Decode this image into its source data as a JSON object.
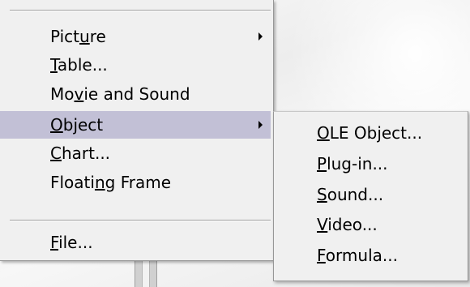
{
  "menu": {
    "items": [
      {
        "before": "Pict",
        "accel": "u",
        "after": "re",
        "has_submenu": true,
        "selected": false
      },
      {
        "before": "",
        "accel": "T",
        "after": "able...",
        "has_submenu": false,
        "selected": false
      },
      {
        "before": "Mo",
        "accel": "v",
        "after": "ie and Sound",
        "has_submenu": false,
        "selected": false
      },
      {
        "before": "",
        "accel": "O",
        "after": "bject",
        "has_submenu": true,
        "selected": true
      },
      {
        "before": "",
        "accel": "C",
        "after": "hart...",
        "has_submenu": false,
        "selected": false
      },
      {
        "before": "Floati",
        "accel": "n",
        "after": "g Frame",
        "has_submenu": false,
        "selected": false
      },
      {
        "before": "",
        "accel": "F",
        "after": "ile...",
        "has_submenu": false,
        "selected": false
      }
    ]
  },
  "submenu": {
    "items": [
      {
        "before": "",
        "accel": "O",
        "after": "LE Object..."
      },
      {
        "before": "",
        "accel": "P",
        "after": "lug-in..."
      },
      {
        "before": "",
        "accel": "S",
        "after": "ound..."
      },
      {
        "before": "",
        "accel": "V",
        "after": "ideo..."
      },
      {
        "before": "",
        "accel": "F",
        "after": "ormula..."
      }
    ]
  },
  "colors": {
    "menu_background": "#f0f0f0",
    "selected_background": "#c2c0d6",
    "border": "#979797"
  },
  "icons": {
    "submenu_arrow": "triangle-right"
  }
}
